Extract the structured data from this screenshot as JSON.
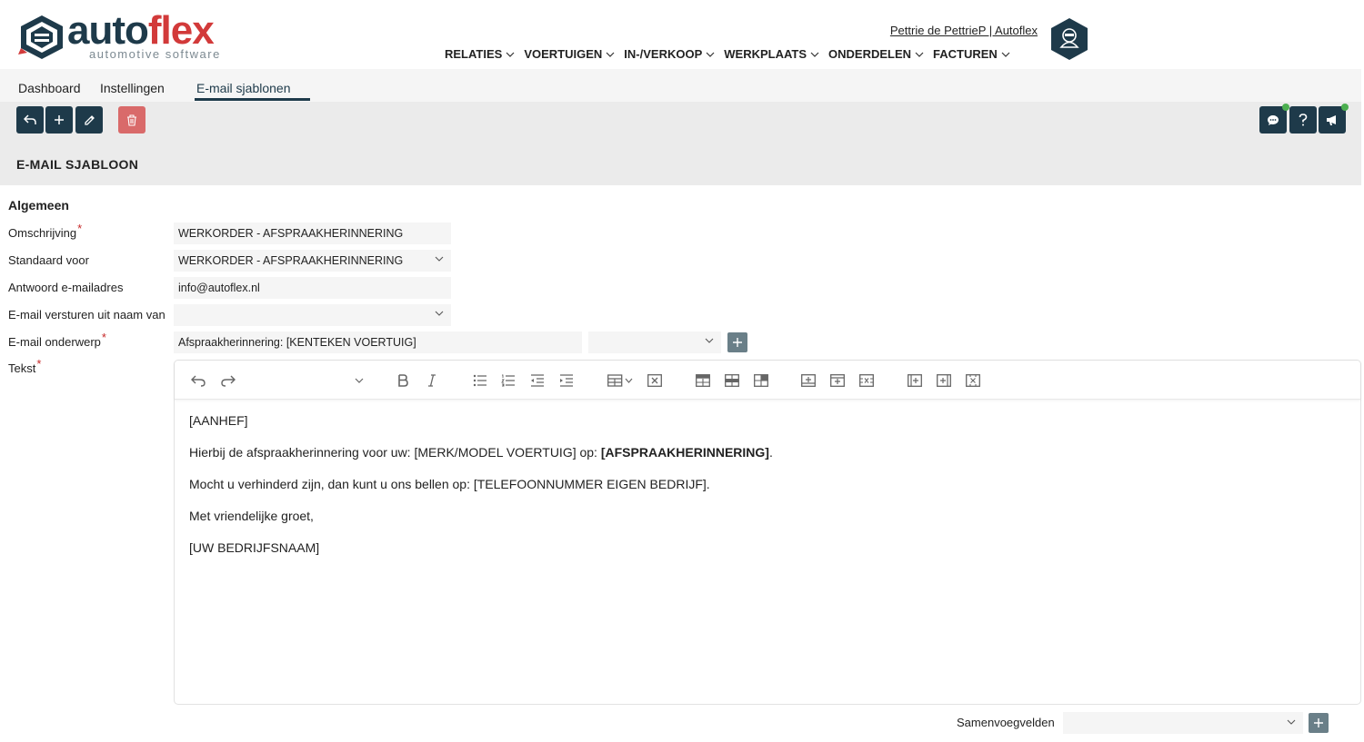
{
  "brand": {
    "name_part1": "auto",
    "name_part2": "flex",
    "tagline": "automotive software",
    "color_primary": "#1e3a4a",
    "color_accent": "#d23a3a"
  },
  "header": {
    "user_link": "Pettrie de PettrieP | Autoflex",
    "avatar_icon": "hacker-avatar-icon",
    "nav": [
      {
        "label": "RELATIES"
      },
      {
        "label": "VOERTUIGEN"
      },
      {
        "label": "IN-/VERKOOP"
      },
      {
        "label": "WERKPLAATS"
      },
      {
        "label": "ONDERDELEN"
      },
      {
        "label": "FACTUREN"
      }
    ]
  },
  "subnav": {
    "tabs": [
      {
        "label": "Dashboard"
      },
      {
        "label": "Instellingen"
      },
      {
        "label": "E-mail sjablonen",
        "active": true
      }
    ]
  },
  "toolbar": {
    "buttons": [
      "back-icon",
      "plus-icon",
      "pencil-icon",
      "trash-icon"
    ],
    "right_buttons": [
      "chat-icon",
      "help-icon",
      "megaphone-icon"
    ],
    "title": "E-MAIL SJABLOON"
  },
  "form": {
    "heading": "Algemeen",
    "omschrijving": {
      "label": "Omschrijving",
      "value": "WERKORDER - AFSPRAAKHERINNERING"
    },
    "standaard_voor": {
      "label": "Standaard voor",
      "value": "WERKORDER - AFSPRAAKHERINNERING"
    },
    "antwoord": {
      "label": "Antwoord e-mailadres",
      "value": "info@autoflex.nl"
    },
    "naam_van": {
      "label": "E-mail versturen uit naam van",
      "value": ""
    },
    "onderwerp": {
      "label": "E-mail onderwerp",
      "value": "Afspraakherinnering: [KENTEKEN VOERTUIG]",
      "select_value": ""
    },
    "tekst": {
      "label": "Tekst"
    },
    "required_mark": "*"
  },
  "editor": {
    "lines": [
      {
        "text": "[AANHEF]"
      },
      {
        "text_before": "Hierbij de afspraakherinnering voor uw: [MERK/MODEL VOERTUIG] op: ",
        "bold": "[AFSPRAAKHERINNERING]",
        "text_after": "."
      },
      {
        "text": "Mocht u verhinderd zijn, dan kunt u ons bellen op: [TELEFOONNUMMER EIGEN BEDRIJF]."
      },
      {
        "text": "Met vriendelijke groet,"
      },
      {
        "text": "[UW BEDRIJFSNAAM]"
      }
    ]
  },
  "footer": {
    "merge_label": "Samenvoegvelden",
    "merge_value": ""
  }
}
